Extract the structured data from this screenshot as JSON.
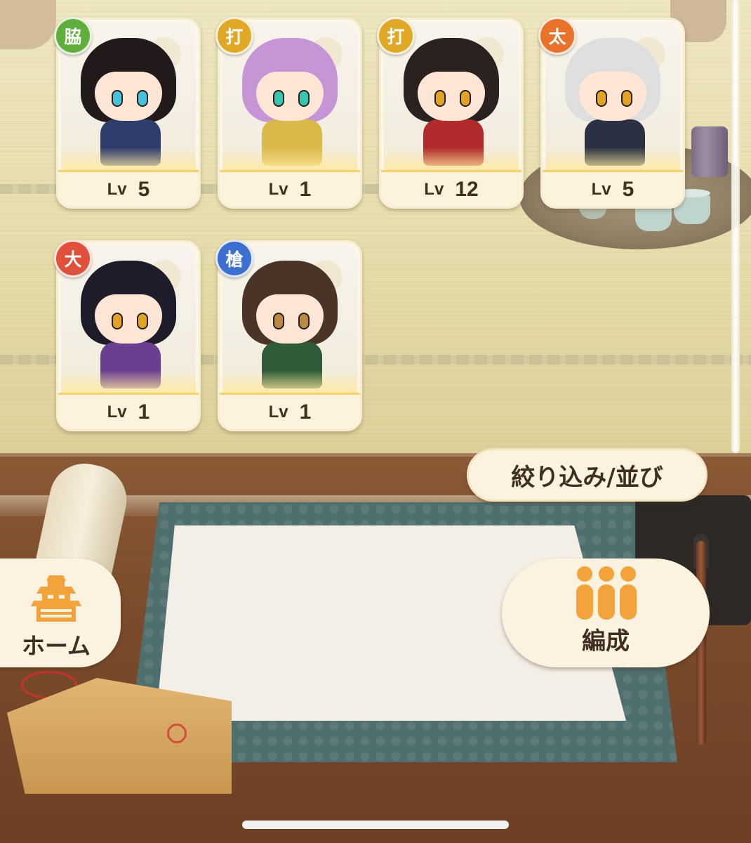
{
  "cards": [
    {
      "badge": "脇",
      "badge_color": "#5fae3b",
      "lv_label": "Lv",
      "level": "5",
      "hair": "#22191a",
      "eyes": "#43c3dd",
      "outfit": "#2f3d6c"
    },
    {
      "badge": "打",
      "badge_color": "#e1a826",
      "lv_label": "Lv",
      "level": "1",
      "hair": "#c595d6",
      "eyes": "#35c7b1",
      "outfit": "#d9b94a"
    },
    {
      "badge": "打",
      "badge_color": "#e1a826",
      "lv_label": "Lv",
      "level": "12",
      "hair": "#2b2220",
      "eyes": "#e2a322",
      "outfit": "#b12b2b"
    },
    {
      "badge": "太",
      "badge_color": "#e8722a",
      "lv_label": "Lv",
      "level": "5",
      "hair": "#dedede",
      "eyes": "#e2a322",
      "outfit": "#2b3142"
    },
    {
      "badge": "大",
      "badge_color": "#e0503b",
      "lv_label": "Lv",
      "level": "1",
      "hair": "#1e1b2b",
      "eyes": "#e2a322",
      "outfit": "#6b3f8f"
    },
    {
      "badge": "槍",
      "badge_color": "#3b6fd0",
      "lv_label": "Lv",
      "level": "1",
      "hair": "#4a3428",
      "eyes": "#b98a43",
      "outfit": "#2f5c38"
    }
  ],
  "filter_button": "絞り込み/並び",
  "home_button": "ホーム",
  "formation_button": "編成",
  "icons": {
    "home": "castle-icon",
    "formation": "three-people-icon"
  },
  "colors": {
    "icon_orange": "#f2a33c",
    "button_bg": "#fbf3e0",
    "text_dark": "#3e2f22"
  }
}
